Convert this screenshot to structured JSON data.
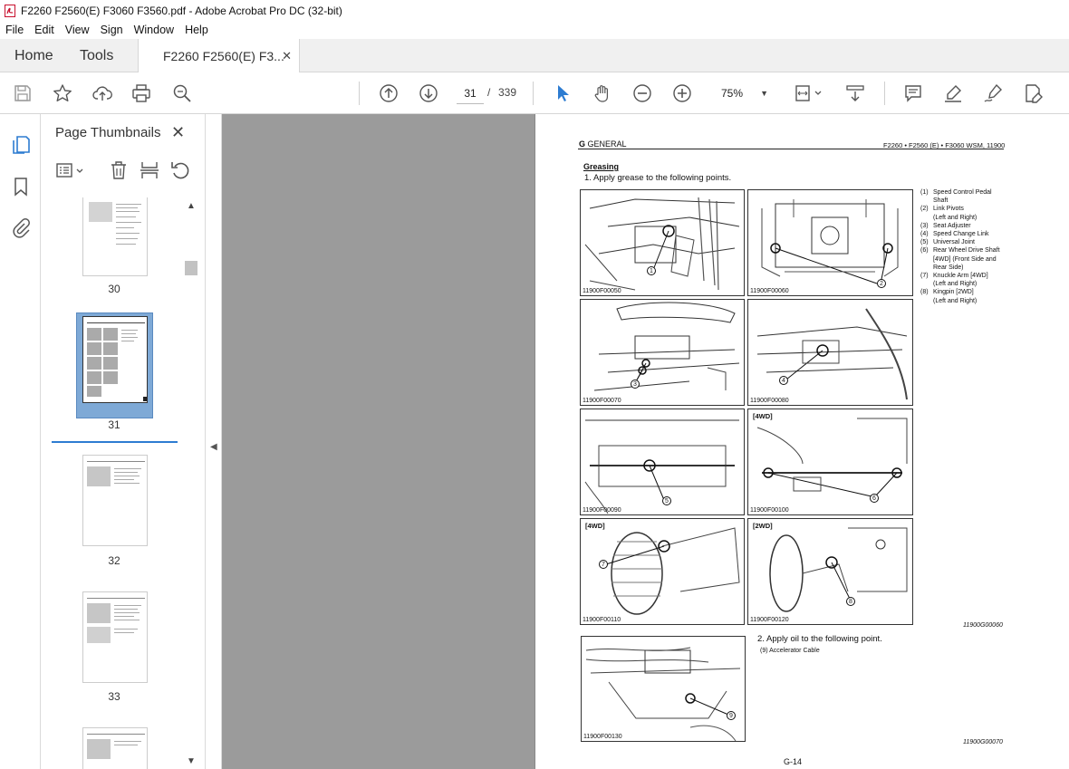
{
  "window": {
    "title": "F2260 F2560(E) F3060 F3560.pdf - Adobe Acrobat Pro DC (32-bit)"
  },
  "menu": [
    "File",
    "Edit",
    "View",
    "Sign",
    "Window",
    "Help"
  ],
  "tabs": {
    "home": "Home",
    "tools": "Tools",
    "doc": "F2260 F2560(E) F3...",
    "doc_close": "✕"
  },
  "toolbar": {
    "current_page": "31",
    "separator": "/",
    "total_pages": "339",
    "zoom": "75%",
    "icons": [
      "save-icon",
      "star-icon",
      "upload-cloud-icon",
      "print-icon",
      "zoom-search-icon",
      "page-up-icon",
      "page-down-icon",
      "select-arrow-icon",
      "hand-tool-icon",
      "zoom-out-icon",
      "zoom-in-icon",
      "fit-page-icon",
      "scroll-mode-icon",
      "comment-icon",
      "highlight-icon",
      "sign-icon",
      "edit-pdf-icon"
    ]
  },
  "panel": {
    "title": "Page Thumbnails",
    "close": "✕",
    "thumbs": [
      {
        "label": "30"
      },
      {
        "label": "31",
        "selected": true
      },
      {
        "label": "32"
      },
      {
        "label": "33"
      }
    ]
  },
  "page": {
    "header_left_bold": "G",
    "header_left": "GENERAL",
    "header_right": "F2260 • F2560 (E) • F3060 WSM, 11900",
    "section": "Greasing",
    "line1": "1.  Apply grease to the following points.",
    "figures": [
      {
        "id": "11900F00050",
        "tag": "",
        "callouts": [
          "1"
        ]
      },
      {
        "id": "11900F00060",
        "tag": "",
        "callouts": [
          "2"
        ]
      },
      {
        "id": "11900F00070",
        "tag": "",
        "callouts": [
          "3"
        ]
      },
      {
        "id": "11900F00080",
        "tag": "",
        "callouts": [
          "4"
        ]
      },
      {
        "id": "11900F00090",
        "tag": "",
        "callouts": [
          "5"
        ]
      },
      {
        "id": "11900F00100",
        "tag": "[4WD]",
        "callouts": [
          "6"
        ]
      },
      {
        "id": "11900F00110",
        "tag": "[4WD]",
        "callouts": [
          "7"
        ]
      },
      {
        "id": "11900F00120",
        "tag": "[2WD]",
        "callouts": [
          "8"
        ]
      },
      {
        "id": "11900F00130",
        "tag": "",
        "callouts": [
          "9"
        ]
      }
    ],
    "legend": [
      {
        "num": "(1)",
        "text": "Speed Control Pedal"
      },
      {
        "num": "",
        "text": "Shaft"
      },
      {
        "num": "(2)",
        "text": "Link Pivots"
      },
      {
        "num": "",
        "text": "(Left and Right)"
      },
      {
        "num": "(3)",
        "text": "Seat Adjuster"
      },
      {
        "num": "(4)",
        "text": "Speed Change Link"
      },
      {
        "num": "(5)",
        "text": "Universal Joint"
      },
      {
        "num": "(6)",
        "text": "Rear Wheel Drive Shaft"
      },
      {
        "num": "",
        "text": "[4WD] (Front Side and"
      },
      {
        "num": "",
        "text": "Rear Side)"
      },
      {
        "num": "(7)",
        "text": "Knuckle Arm [4WD]"
      },
      {
        "num": "",
        "text": "(Left and Right)"
      },
      {
        "num": "(8)",
        "text": "Kingpin [2WD]"
      },
      {
        "num": "",
        "text": "(Left and Right)"
      }
    ],
    "code1": "11900G00060",
    "line2": "2.  Apply oil to the following point.",
    "item9": "(9)    Accelerator Cable",
    "code2": "11900G00070",
    "page_number": "G-14"
  }
}
